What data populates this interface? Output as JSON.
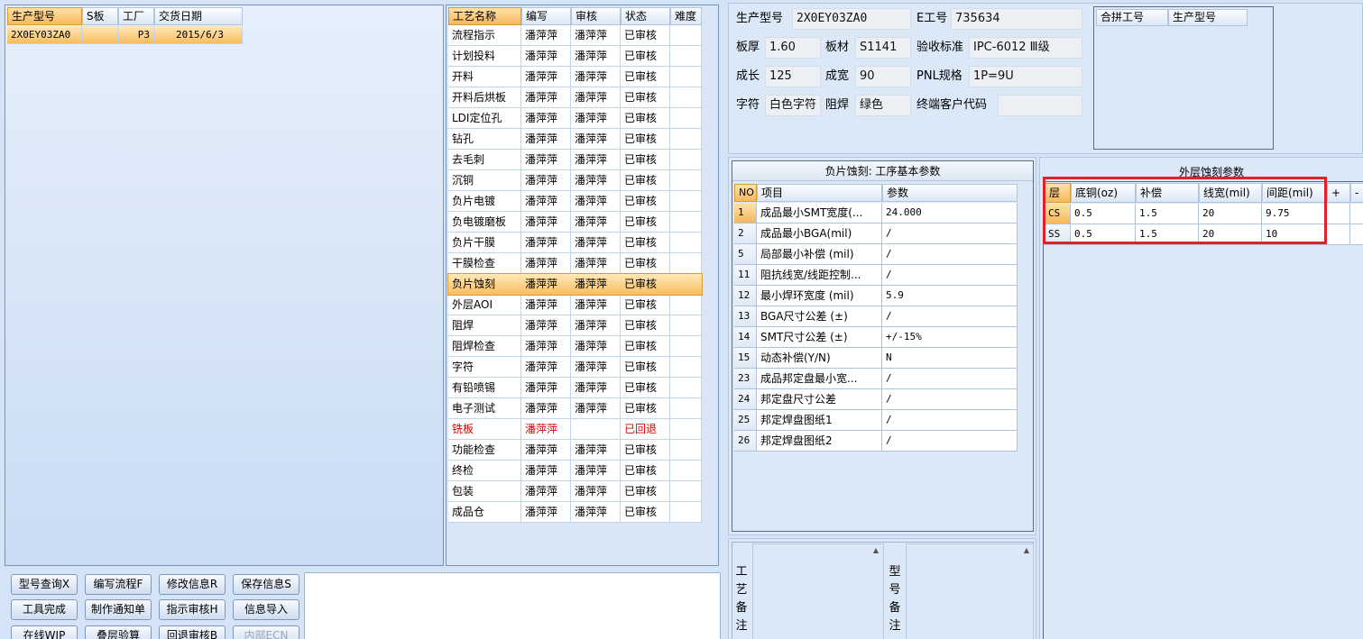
{
  "orders": {
    "columns": [
      "生产型号",
      "S板",
      "工厂",
      "交货日期"
    ],
    "rows": [
      {
        "model": "2X0EY03ZA0",
        "s": "",
        "factory": "P3",
        "date": "2015/6/3"
      }
    ]
  },
  "process": {
    "columns": [
      "工艺名称",
      "编写",
      "审核",
      "状态",
      "难度"
    ],
    "rows": [
      {
        "name": "流程指示",
        "writer": "潘萍萍",
        "reviewer": "潘萍萍",
        "status": "已审核"
      },
      {
        "name": "计划投料",
        "writer": "潘萍萍",
        "reviewer": "潘萍萍",
        "status": "已审核"
      },
      {
        "name": "开料",
        "writer": "潘萍萍",
        "reviewer": "潘萍萍",
        "status": "已审核"
      },
      {
        "name": "开料后烘板",
        "writer": "潘萍萍",
        "reviewer": "潘萍萍",
        "status": "已审核"
      },
      {
        "name": "LDI定位孔",
        "writer": "潘萍萍",
        "reviewer": "潘萍萍",
        "status": "已审核"
      },
      {
        "name": "钻孔",
        "writer": "潘萍萍",
        "reviewer": "潘萍萍",
        "status": "已审核"
      },
      {
        "name": "去毛刺",
        "writer": "潘萍萍",
        "reviewer": "潘萍萍",
        "status": "已审核"
      },
      {
        "name": "沉铜",
        "writer": "潘萍萍",
        "reviewer": "潘萍萍",
        "status": "已审核"
      },
      {
        "name": "负片电镀",
        "writer": "潘萍萍",
        "reviewer": "潘萍萍",
        "status": "已审核"
      },
      {
        "name": "负电镀磨板",
        "writer": "潘萍萍",
        "reviewer": "潘萍萍",
        "status": "已审核"
      },
      {
        "name": "负片干膜",
        "writer": "潘萍萍",
        "reviewer": "潘萍萍",
        "status": "已审核"
      },
      {
        "name": "干膜检查",
        "writer": "潘萍萍",
        "reviewer": "潘萍萍",
        "status": "已审核"
      },
      {
        "name": "负片蚀刻",
        "writer": "潘萍萍",
        "reviewer": "潘萍萍",
        "status": "已审核",
        "selected": true
      },
      {
        "name": "外层AOI",
        "writer": "潘萍萍",
        "reviewer": "潘萍萍",
        "status": "已审核"
      },
      {
        "name": "阻焊",
        "writer": "潘萍萍",
        "reviewer": "潘萍萍",
        "status": "已审核"
      },
      {
        "name": "阻焊检查",
        "writer": "潘萍萍",
        "reviewer": "潘萍萍",
        "status": "已审核"
      },
      {
        "name": "字符",
        "writer": "潘萍萍",
        "reviewer": "潘萍萍",
        "status": "已审核"
      },
      {
        "name": "有铅喷锡",
        "writer": "潘萍萍",
        "reviewer": "潘萍萍",
        "status": "已审核"
      },
      {
        "name": "电子测试",
        "writer": "潘萍萍",
        "reviewer": "潘萍萍",
        "status": "已审核"
      },
      {
        "name": "铣板",
        "writer": "潘萍萍",
        "reviewer": "",
        "status": "已回退",
        "returned": true
      },
      {
        "name": "功能检查",
        "writer": "潘萍萍",
        "reviewer": "潘萍萍",
        "status": "已审核"
      },
      {
        "name": "终检",
        "writer": "潘萍萍",
        "reviewer": "潘萍萍",
        "status": "已审核"
      },
      {
        "name": "包装",
        "writer": "潘萍萍",
        "reviewer": "潘萍萍",
        "status": "已审核"
      },
      {
        "name": "成品仓",
        "writer": "潘萍萍",
        "reviewer": "潘萍萍",
        "status": "已审核"
      }
    ]
  },
  "info": {
    "model_label": "生产型号",
    "model_value": "2X0EY03ZA0",
    "eno_label": "E工号",
    "eno_value": "735634",
    "thick_label": "板厚",
    "thick_value": "1.60",
    "material_label": "板材",
    "material_value": "S1141",
    "standard_label": "验收标准",
    "standard_value": "IPC-6012 Ⅲ级",
    "length_label": "成长",
    "length_value": "125",
    "width_label": "成宽",
    "width_value": "90",
    "pnl_label": "PNL规格",
    "pnl_value": "1P=9U",
    "char_label": "字符",
    "char_value": "白色字符",
    "mask_label": "阻焊",
    "mask_value": "绿色",
    "customer_label": "终端客户代码",
    "customer_value": ""
  },
  "merge": {
    "columns": [
      "合拼工号",
      "生产型号"
    ]
  },
  "params": {
    "title": "负片蚀刻: 工序基本参数",
    "columns": [
      "NO",
      "项目",
      "参数"
    ],
    "rows": [
      {
        "no": "1",
        "item": "成品最小SMT宽度(...",
        "value": "24.000",
        "selected": true
      },
      {
        "no": "2",
        "item": "成品最小BGA(mil)",
        "value": "/"
      },
      {
        "no": "5",
        "item": "局部最小补偿 (mil)",
        "value": "/"
      },
      {
        "no": "11",
        "item": "阻抗线宽/线距控制...",
        "value": "/"
      },
      {
        "no": "12",
        "item": "最小焊环宽度 (mil)",
        "value": "5.9"
      },
      {
        "no": "13",
        "item": "BGA尺寸公差 (±)",
        "value": "/"
      },
      {
        "no": "14",
        "item": "SMT尺寸公差 (±)",
        "value": "+/-15%"
      },
      {
        "no": "15",
        "item": "动态补偿(Y/N)",
        "value": "N"
      },
      {
        "no": "23",
        "item": "成品邦定盘最小宽...",
        "value": "/"
      },
      {
        "no": "24",
        "item": "邦定盘尺寸公差",
        "value": "/"
      },
      {
        "no": "25",
        "item": "邦定焊盘图纸1",
        "value": "/"
      },
      {
        "no": "26",
        "item": "邦定焊盘图纸2",
        "value": "/"
      }
    ]
  },
  "etch": {
    "title": "外层蚀刻参数",
    "columns": [
      "层",
      "底铜(oz)",
      "补偿",
      "线宽(mil)",
      "间距(mil)",
      "+",
      "-"
    ],
    "rows": [
      {
        "layer": "CS",
        "copper": "0.5",
        "comp": "1.5",
        "line": "20",
        "space": "9.75"
      },
      {
        "layer": "SS",
        "copper": "0.5",
        "comp": "1.5",
        "line": "20",
        "space": "10"
      }
    ],
    "highlight_color": "#e0202a"
  },
  "notes": {
    "process_label": [
      "工",
      "艺",
      "备",
      "注"
    ],
    "model_label": [
      "型",
      "号",
      "备",
      "注"
    ]
  },
  "buttons": {
    "row1": [
      "型号查询X",
      "编写流程F",
      "修改信息R",
      "保存信息S"
    ],
    "row2": [
      "工具完成",
      "制作通知单",
      "指示审核H",
      "信息导入"
    ],
    "row3": [
      "在线WIP",
      "叠层验算",
      "回退审核B",
      "内部ECN"
    ]
  }
}
